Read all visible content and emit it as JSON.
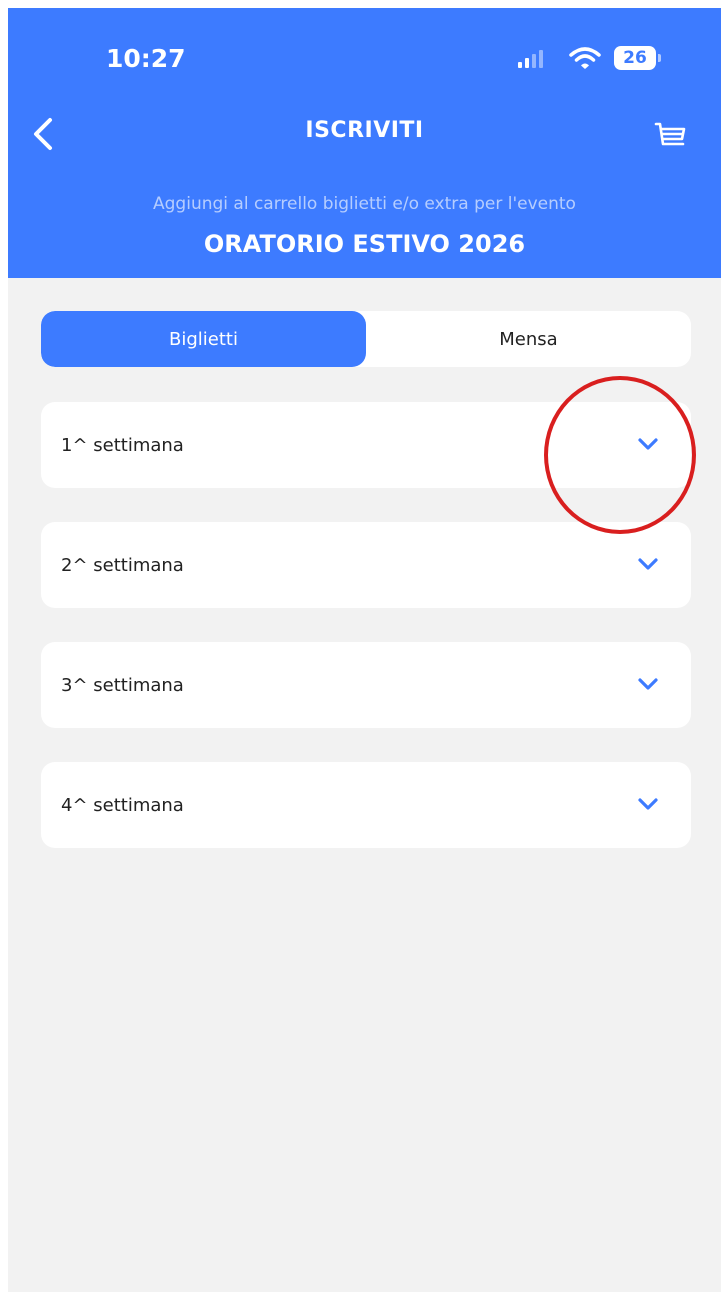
{
  "status_bar": {
    "time": "10:27",
    "battery": "26"
  },
  "header": {
    "title": "ISCRIVITI",
    "subtitle": "Aggiungi al carrello biglietti e/o extra per l'evento",
    "event_name": "ORATORIO ESTIVO 2026"
  },
  "tabs": [
    {
      "label": "Biglietti",
      "active": true
    },
    {
      "label": "Mensa",
      "active": false
    }
  ],
  "weeks": [
    {
      "label": "1^ settimana"
    },
    {
      "label": "2^ settimana"
    },
    {
      "label": "3^ settimana"
    },
    {
      "label": "4^ settimana"
    }
  ],
  "colors": {
    "accent": "#3d7bff",
    "background": "#f2f2f2",
    "annotation": "#d91f1f"
  }
}
